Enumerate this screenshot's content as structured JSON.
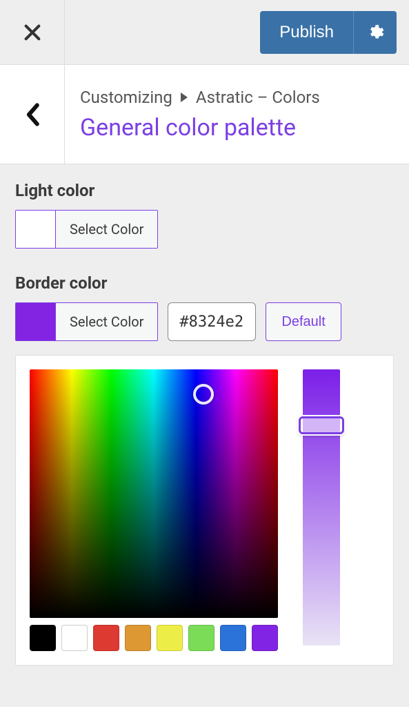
{
  "topbar": {
    "publish_label": "Publish"
  },
  "breadcrumb": {
    "root": "Customizing",
    "path": "Astratic – Colors",
    "title": "General color palette"
  },
  "sections": {
    "light": {
      "label": "Light color",
      "select_label": "Select Color",
      "swatch_color": "#ffffff"
    },
    "border": {
      "label": "Border color",
      "select_label": "Select Color",
      "swatch_color": "#8324e2",
      "hex_value": "#8324e2",
      "default_label": "Default"
    }
  },
  "picker": {
    "preset_swatches": [
      {
        "name": "black",
        "hex": "#000000"
      },
      {
        "name": "white",
        "hex": "#ffffff"
      },
      {
        "name": "red",
        "hex": "#dd3a31"
      },
      {
        "name": "orange",
        "hex": "#dd9833"
      },
      {
        "name": "yellow",
        "hex": "#eded47"
      },
      {
        "name": "green",
        "hex": "#7bdc57"
      },
      {
        "name": "blue",
        "hex": "#2b72d9"
      },
      {
        "name": "purple",
        "hex": "#8224e3"
      }
    ]
  }
}
